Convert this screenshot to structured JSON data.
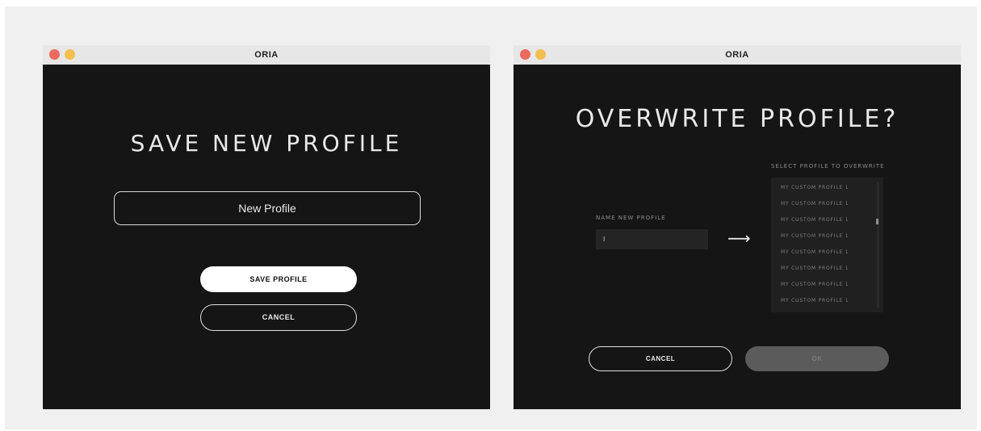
{
  "windows": [
    {
      "title": "ORIA",
      "heading": "SAVE NEW PROFILE",
      "name_field": {
        "value": "New Profile",
        "placeholder": ""
      },
      "save_label": "SAVE PROFILE",
      "cancel_label": "CANCEL"
    },
    {
      "title": "ORIA",
      "heading": "OVERWRITE PROFILE?",
      "select_label": "SELECT PROFILE TO OVERWRITE",
      "profiles": [
        "MY CUSTOM PROFILE 1",
        "MY CUSTOM PROFILE 1",
        "MY CUSTOM PROFILE 1",
        "MY CUSTOM PROFILE 1",
        "MY CUSTOM PROFILE 1",
        "MY CUSTOM PROFILE 1",
        "MY CUSTOM PROFILE 1",
        "MY CUSTOM PROFILE 1"
      ],
      "name_label": "NAME NEW PROFILE",
      "name_input": {
        "value": "I"
      },
      "arrow_icon": "long-right-arrow-icon",
      "cancel_label": "CANCEL",
      "ok_label": "OK"
    }
  ],
  "colors": {
    "window_bg": "#151515",
    "titlebar_bg": "#e7e7e7",
    "close_dot": "#ec6a5e",
    "minimize_dot": "#f4bf4f",
    "primary_button": "#ffffff",
    "disabled_button": "#5b5b5b"
  }
}
